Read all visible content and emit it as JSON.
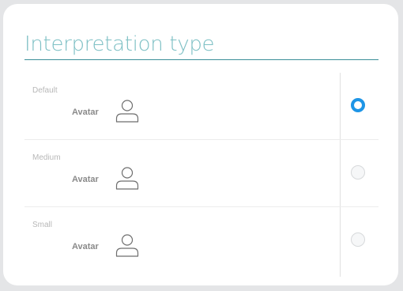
{
  "panel": {
    "title": "Interpretation type"
  },
  "options": [
    {
      "label": "Default",
      "field_label": "Avatar",
      "icon": "user-avatar-icon",
      "selected": true
    },
    {
      "label": "Medium",
      "field_label": "Avatar",
      "icon": "user-avatar-icon",
      "selected": false
    },
    {
      "label": "Small",
      "field_label": "Avatar",
      "icon": "user-avatar-icon",
      "selected": false
    }
  ],
  "colors": {
    "title": "#7ec0c5",
    "title_underline": "#3c8f98",
    "radio_selected": "#1e95e6",
    "radio_unselected_border": "#d7d9db"
  }
}
